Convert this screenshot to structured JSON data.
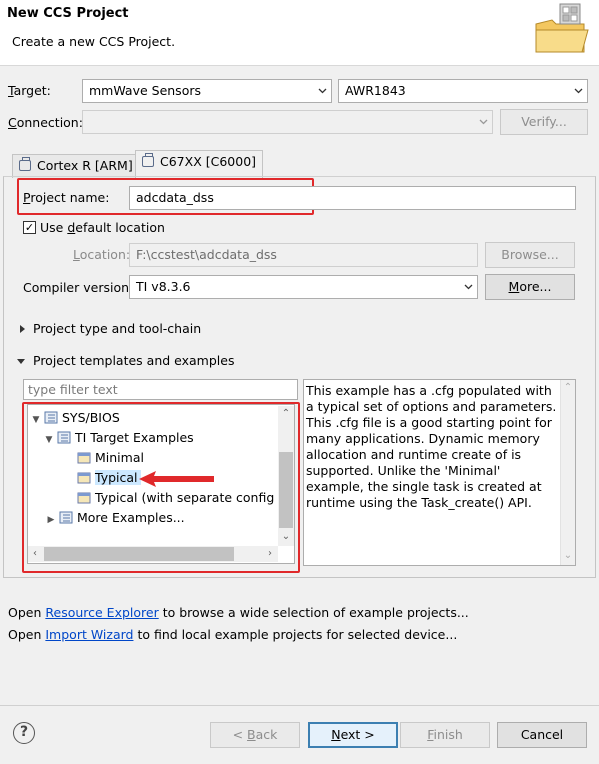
{
  "dialog": {
    "title": "New CCS Project",
    "subtitle": "Create a new CCS Project."
  },
  "target": {
    "label_pre": "",
    "label_mnemonic": "T",
    "label_post": "arget:",
    "family": "mmWave Sensors",
    "device": "AWR1843"
  },
  "connection": {
    "label_mnemonic": "C",
    "label_post": "onnection:",
    "value": "",
    "verify_label": "Verify..."
  },
  "tabs": [
    {
      "label": "Cortex R [ARM]",
      "active": false
    },
    {
      "label": "C67XX [C6000]",
      "active": true
    }
  ],
  "project": {
    "name_label_mnemonic": "P",
    "name_label_post": "roject name:",
    "name_value": "adcdata_dss",
    "use_default_location_pre": "Use ",
    "use_default_location_mnemonic": "d",
    "use_default_location_post": "efault location",
    "use_default_location_checked": true,
    "location_label_mnemonic": "L",
    "location_label_post": "ocation:",
    "location_value": "F:\\ccstest\\adcdata_dss",
    "browse_label": "Browse...",
    "compiler_label": "Compiler version:",
    "compiler_value": "TI v8.3.6",
    "more_label": "More..."
  },
  "sections": {
    "type_toolchain": "Project type and tool-chain",
    "templates": "Project templates and examples"
  },
  "templates": {
    "filter_placeholder": "type filter text",
    "tree": [
      {
        "label": "SYS/BIOS",
        "expander": "v",
        "icon": "folder-doc-icon"
      },
      {
        "label": "TI Target Examples",
        "expander": "v",
        "icon": "folder-doc-icon"
      },
      {
        "label": "Minimal",
        "expander": "",
        "icon": "template-icon"
      },
      {
        "label": "Typical",
        "expander": "",
        "icon": "template-icon",
        "selected": true
      },
      {
        "label": "Typical (with separate config pr",
        "expander": "",
        "icon": "template-icon"
      },
      {
        "label": "More Examples...",
        "expander": ">",
        "icon": "folder-doc-icon"
      }
    ],
    "description": "This example has a .cfg populated with a typical set of options and parameters. This .cfg file is a good starting point for many applications.  Dynamic memory allocation and runtime create of is supported.  Unlike the 'Minimal' example, the single task is created at runtime using the Task_create() API."
  },
  "info_lines": [
    {
      "pre": "Open ",
      "link": "Resource Explorer",
      "post": " to browse a wide selection of example projects..."
    },
    {
      "pre": "Open ",
      "link": "Import Wizard",
      "post": " to find local example projects for selected device..."
    }
  ],
  "buttons": {
    "help": "?",
    "back_pre": "< ",
    "back_mnemonic": "B",
    "back_post": "ack",
    "next_mnemonic": "N",
    "next_post": "ext >",
    "finish_mnemonic": "F",
    "finish_post": "inish",
    "cancel": "Cancel"
  },
  "colors": {
    "annotation": "#e0292b",
    "link": "#0046c8",
    "selection": "#cce8ff"
  }
}
